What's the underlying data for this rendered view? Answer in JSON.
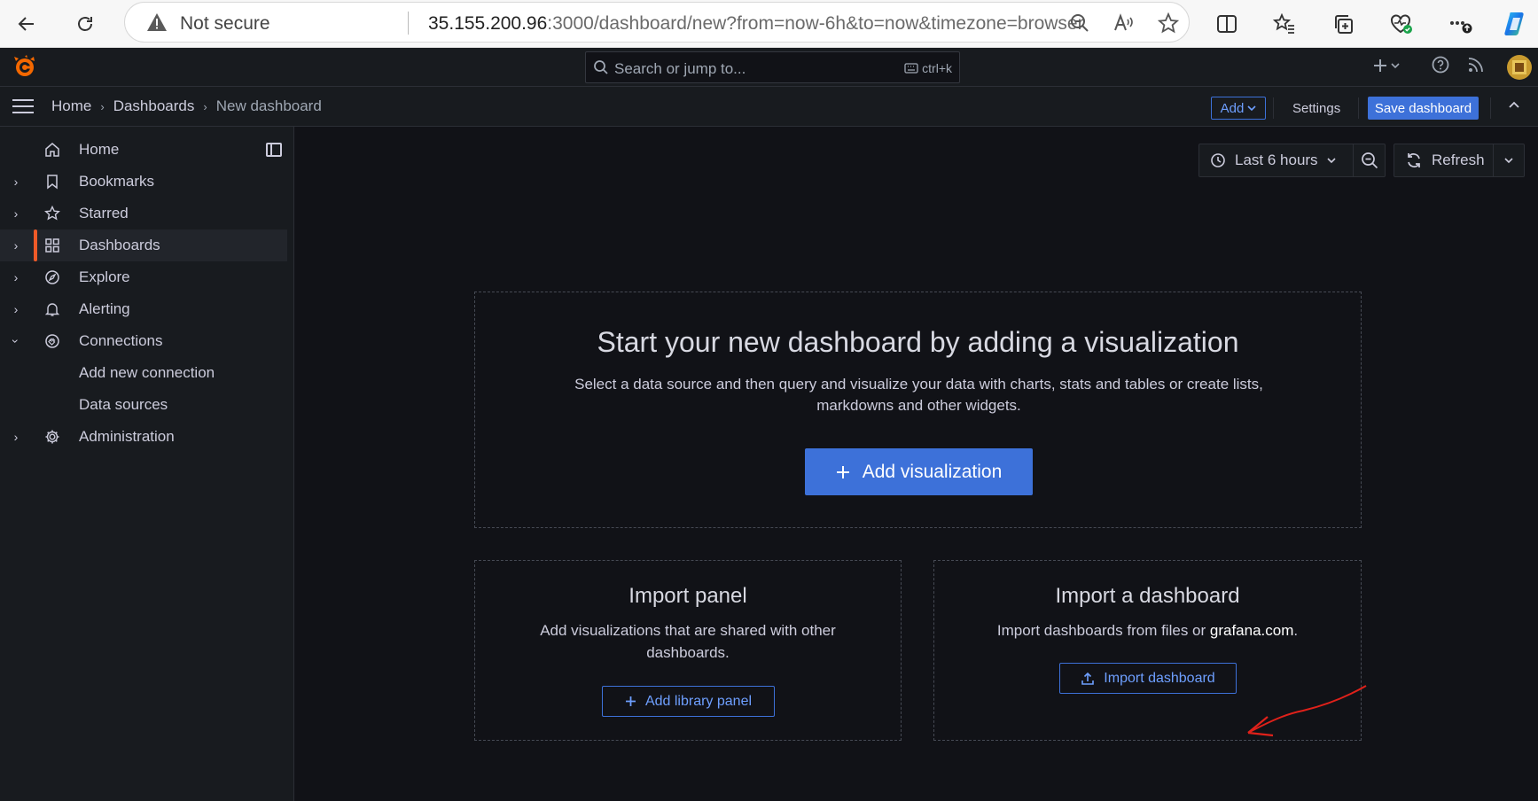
{
  "browser": {
    "not_secure": "Not secure",
    "url_host": "35.155.200.96",
    "url_rest": ":3000/dashboard/new?from=now-6h&to=now&timezone=browser"
  },
  "topbar": {
    "search_placeholder": "Search or jump to...",
    "search_shortcut": "ctrl+k"
  },
  "breadcrumb": [
    "Home",
    "Dashboards",
    "New dashboard"
  ],
  "toolbar": {
    "add_label": "Add",
    "settings_label": "Settings",
    "save_label": "Save dashboard"
  },
  "sidebar": {
    "items": [
      {
        "label": "Home",
        "icon": "home-icon"
      },
      {
        "label": "Bookmarks",
        "icon": "bookmark-icon"
      },
      {
        "label": "Starred",
        "icon": "star-icon"
      },
      {
        "label": "Dashboards",
        "icon": "apps-icon",
        "active": true
      },
      {
        "label": "Explore",
        "icon": "compass-icon"
      },
      {
        "label": "Alerting",
        "icon": "bell-icon"
      },
      {
        "label": "Connections",
        "icon": "plug-icon",
        "expanded": true
      },
      {
        "label": "Add new connection"
      },
      {
        "label": "Data sources"
      },
      {
        "label": "Administration",
        "icon": "cog-icon"
      }
    ]
  },
  "time_picker": {
    "label": "Last 6 hours"
  },
  "refresh": {
    "label": "Refresh"
  },
  "empty_state": {
    "title": "Start your new dashboard by adding a visualization",
    "description": "Select a data source and then query and visualize your data with charts, stats and tables or create lists, markdowns and other widgets.",
    "button": "Add visualization"
  },
  "import_panel": {
    "title": "Import panel",
    "description": "Add visualizations that are shared with other dashboards.",
    "button": "Add library panel"
  },
  "import_dashboard": {
    "title": "Import a dashboard",
    "description_prefix": "Import dashboards from files or ",
    "description_link": "grafana.com",
    "description_suffix": ".",
    "button": "Import dashboard"
  },
  "colors": {
    "bg": "#111217",
    "panel": "#181b1f",
    "primary": "#3d71d9",
    "accent_orange": "#f05a28",
    "annotation_red": "#e0211a"
  }
}
